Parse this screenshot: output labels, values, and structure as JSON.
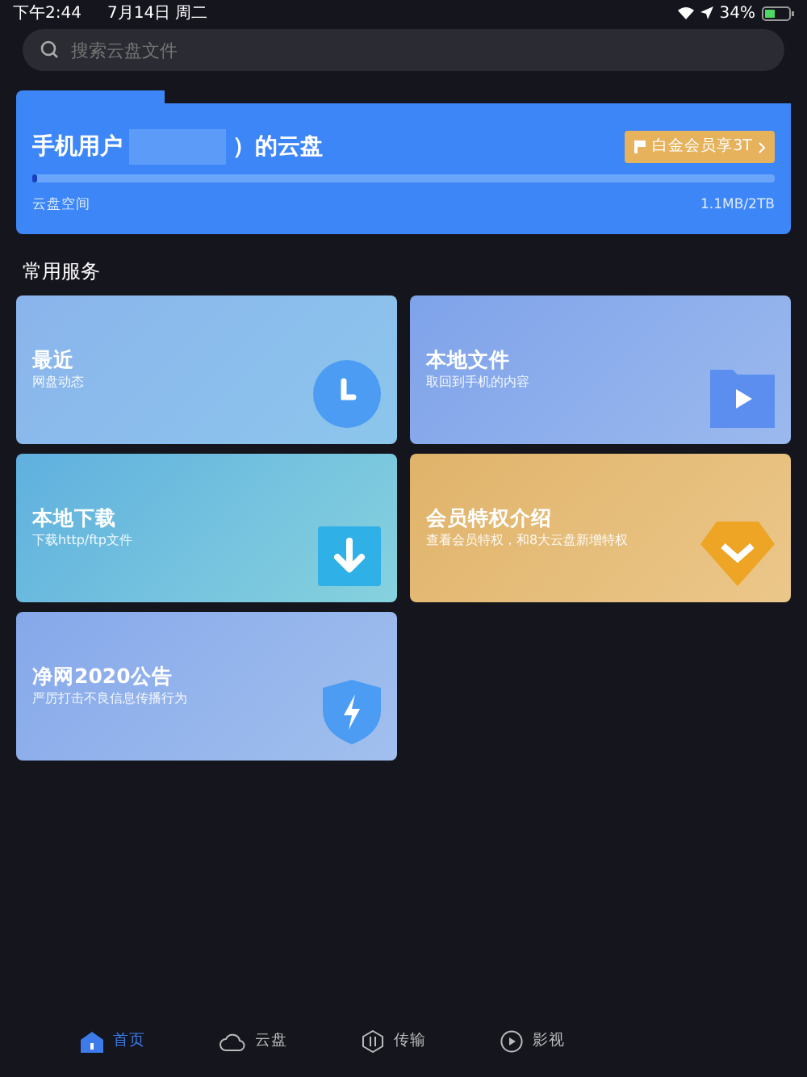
{
  "status_bar": {
    "time": "下午2:44",
    "date": "7月14日 周二",
    "battery": "34%"
  },
  "search": {
    "placeholder": "搜索云盘文件"
  },
  "storage": {
    "title_prefix": "手机用户",
    "title_suffix": "）的云盘",
    "badge": "白金会员享3T",
    "label": "云盘空间",
    "usage": "1.1MB/2TB",
    "level": 0.005
  },
  "section_title": "常用服务",
  "services": [
    {
      "kind": "clock",
      "title": "最近",
      "subtitle": "网盘动态"
    },
    {
      "kind": "folder",
      "title": "本地文件",
      "subtitle": "取回到手机的内容"
    },
    {
      "kind": "download",
      "title": "本地下载",
      "subtitle": "下载http/ftp文件"
    },
    {
      "kind": "gem",
      "title": "会员特权介绍",
      "subtitle": "查看会员特权，和8大云盘新增特权"
    },
    {
      "kind": "shield",
      "title": "净网2020公告",
      "subtitle": "严厉打击不良信息传播行为"
    }
  ],
  "tab_bar": [
    {
      "kind": "home",
      "label": "首页",
      "selected": true
    },
    {
      "kind": "cloud",
      "label": "云盘",
      "selected": false
    },
    {
      "kind": "transfer",
      "label": "传输",
      "selected": false
    },
    {
      "kind": "play",
      "label": "影视",
      "selected": false
    }
  ]
}
